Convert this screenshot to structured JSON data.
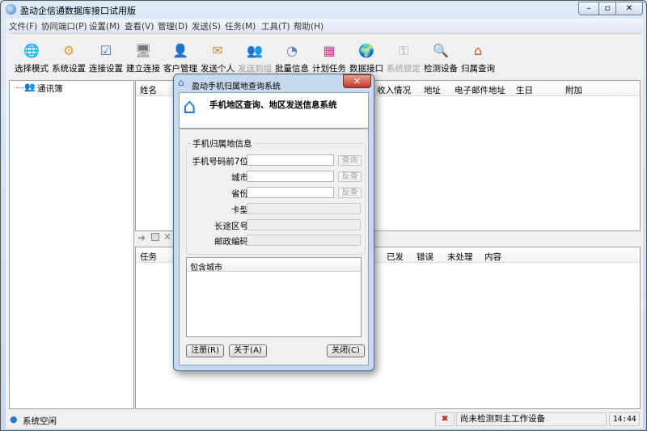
{
  "window": {
    "title": "盈动企信通数据库接口试用版",
    "min": "–",
    "max": "▫",
    "close": "✕"
  },
  "menu": [
    "文件(F)",
    "协同端口(P)",
    "设置(M)",
    "查看(V)",
    "管理(D)",
    "发送(S)",
    "任务(M)",
    "工具(T)",
    "帮助(H)"
  ],
  "toolbar": [
    {
      "label": "选择模式",
      "icon": "globe-computer-icon",
      "glyph": "🌐",
      "color": "#3b8ad9",
      "disabled": false
    },
    {
      "label": "系统设置",
      "icon": "gears-icon",
      "glyph": "⚙",
      "color": "#d8a02a",
      "disabled": false
    },
    {
      "label": "连接设置",
      "icon": "checklist-icon",
      "glyph": "☑",
      "color": "#3a6fc2",
      "disabled": false
    },
    {
      "label": "建立连接",
      "icon": "network-computer-icon",
      "glyph": "🖥",
      "color": "#777",
      "disabled": false
    },
    {
      "label": "客户管理",
      "icon": "user-icon",
      "glyph": "👤",
      "color": "#3f9f3f",
      "disabled": false
    },
    {
      "label": "发送个人",
      "icon": "send-user-icon",
      "glyph": "✉",
      "color": "#d08a3a",
      "disabled": false
    },
    {
      "label": "发送到组",
      "icon": "group-icon",
      "glyph": "👥",
      "color": "#aaa",
      "disabled": true
    },
    {
      "label": "批量信息",
      "icon": "pie-chart-icon",
      "glyph": "◔",
      "color": "#5a7fd0",
      "disabled": false
    },
    {
      "label": "计划任务",
      "icon": "blocks-icon",
      "glyph": "▦",
      "color": "#d03a8a",
      "disabled": false
    },
    {
      "label": "数据接口",
      "icon": "globe-icon",
      "glyph": "🌍",
      "color": "#2a8a3a",
      "disabled": false
    },
    {
      "label": "系统锁定",
      "icon": "key-icon",
      "glyph": "⚿",
      "color": "#aaa",
      "disabled": true
    },
    {
      "label": "检测设备",
      "icon": "magnifier-icon",
      "glyph": "🔍",
      "color": "#6aaee0",
      "disabled": false
    },
    {
      "label": "归属查询",
      "icon": "house-icon",
      "glyph": "⌂",
      "color": "#d0502a",
      "disabled": false
    }
  ],
  "tree": {
    "root": "通讯簿"
  },
  "contacts_headers": [
    "姓名",
    "收入情况",
    "地址",
    "电子邮件地址",
    "生日",
    "附加"
  ],
  "task_headers": [
    "任务",
    "已发",
    "错误",
    "未处理",
    "内容"
  ],
  "dialog": {
    "title": "盈动手机归属地查询系统",
    "heading": "手机地区查询、地区发送信息系统",
    "group": "手机归属地信息",
    "fields": {
      "prefix": "手机号码前7位",
      "city": "城市",
      "province": "省份",
      "card": "卡型",
      "areacode": "长途区号",
      "zip": "邮政编码"
    },
    "query_btn": "查询",
    "reverse_btn": "反查",
    "cities_header": "包含城市",
    "register": "注册(R)",
    "about": "关于(A)",
    "close": "关闭(C)"
  },
  "status": {
    "state": "系统空闲",
    "device": "尚未检测到主工作设备",
    "time": "14:44"
  }
}
